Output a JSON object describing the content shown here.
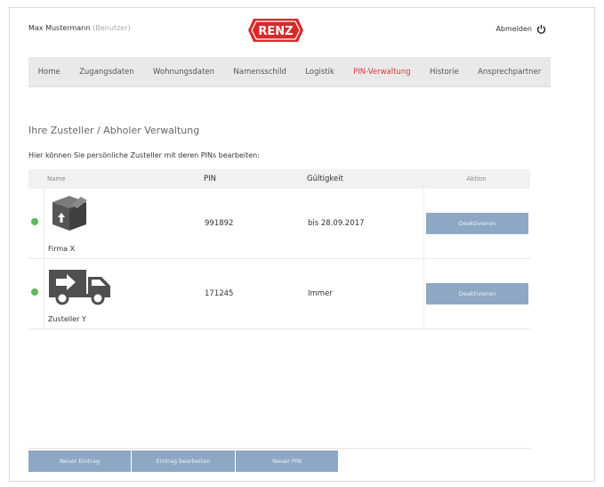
{
  "header": {
    "user": "Max Mustermann",
    "role": "(Benutzer)",
    "logo": "RENZ",
    "logout": "Abmelden",
    "brand_color": "#d42b2b"
  },
  "nav": {
    "tabs": [
      {
        "label": "Home"
      },
      {
        "label": "Zugangsdaten"
      },
      {
        "label": "Wohnungsdaten"
      },
      {
        "label": "Namensschild"
      },
      {
        "label": "Logistik"
      },
      {
        "label": "PIN-Verwaltung",
        "active": true
      },
      {
        "label": "Historie"
      },
      {
        "label": "Ansprechpartner"
      }
    ],
    "active_color": "#d33a3a"
  },
  "page": {
    "title": "Ihre Zusteller / Abholer Verwaltung",
    "intro": "Hier können Sie persönliche Zusteller mit deren PINs bearbeiten:"
  },
  "table": {
    "headers": {
      "name": "Name",
      "pin": "PIN",
      "valid": "Gültigkeit",
      "actions": "Aktion"
    },
    "rows": [
      {
        "name": "Firma X",
        "pin": "991892",
        "valid": "bis 28.09.2017",
        "action": "Deaktivieren",
        "icon": "package-icon",
        "status": "active"
      },
      {
        "name": "Zusteller Y",
        "pin": "171245",
        "valid": "Immer",
        "action": "Deaktivieren",
        "icon": "delivery-truck-icon",
        "status": "active"
      }
    ]
  },
  "actions": {
    "new_entry": "Neuer Eintrag",
    "edit_entry": "Eintrag bearbeiten",
    "new_pin": "Neuer PIN"
  },
  "colors": {
    "button": "#8ea8c3",
    "status_active": "#5cb85c"
  }
}
